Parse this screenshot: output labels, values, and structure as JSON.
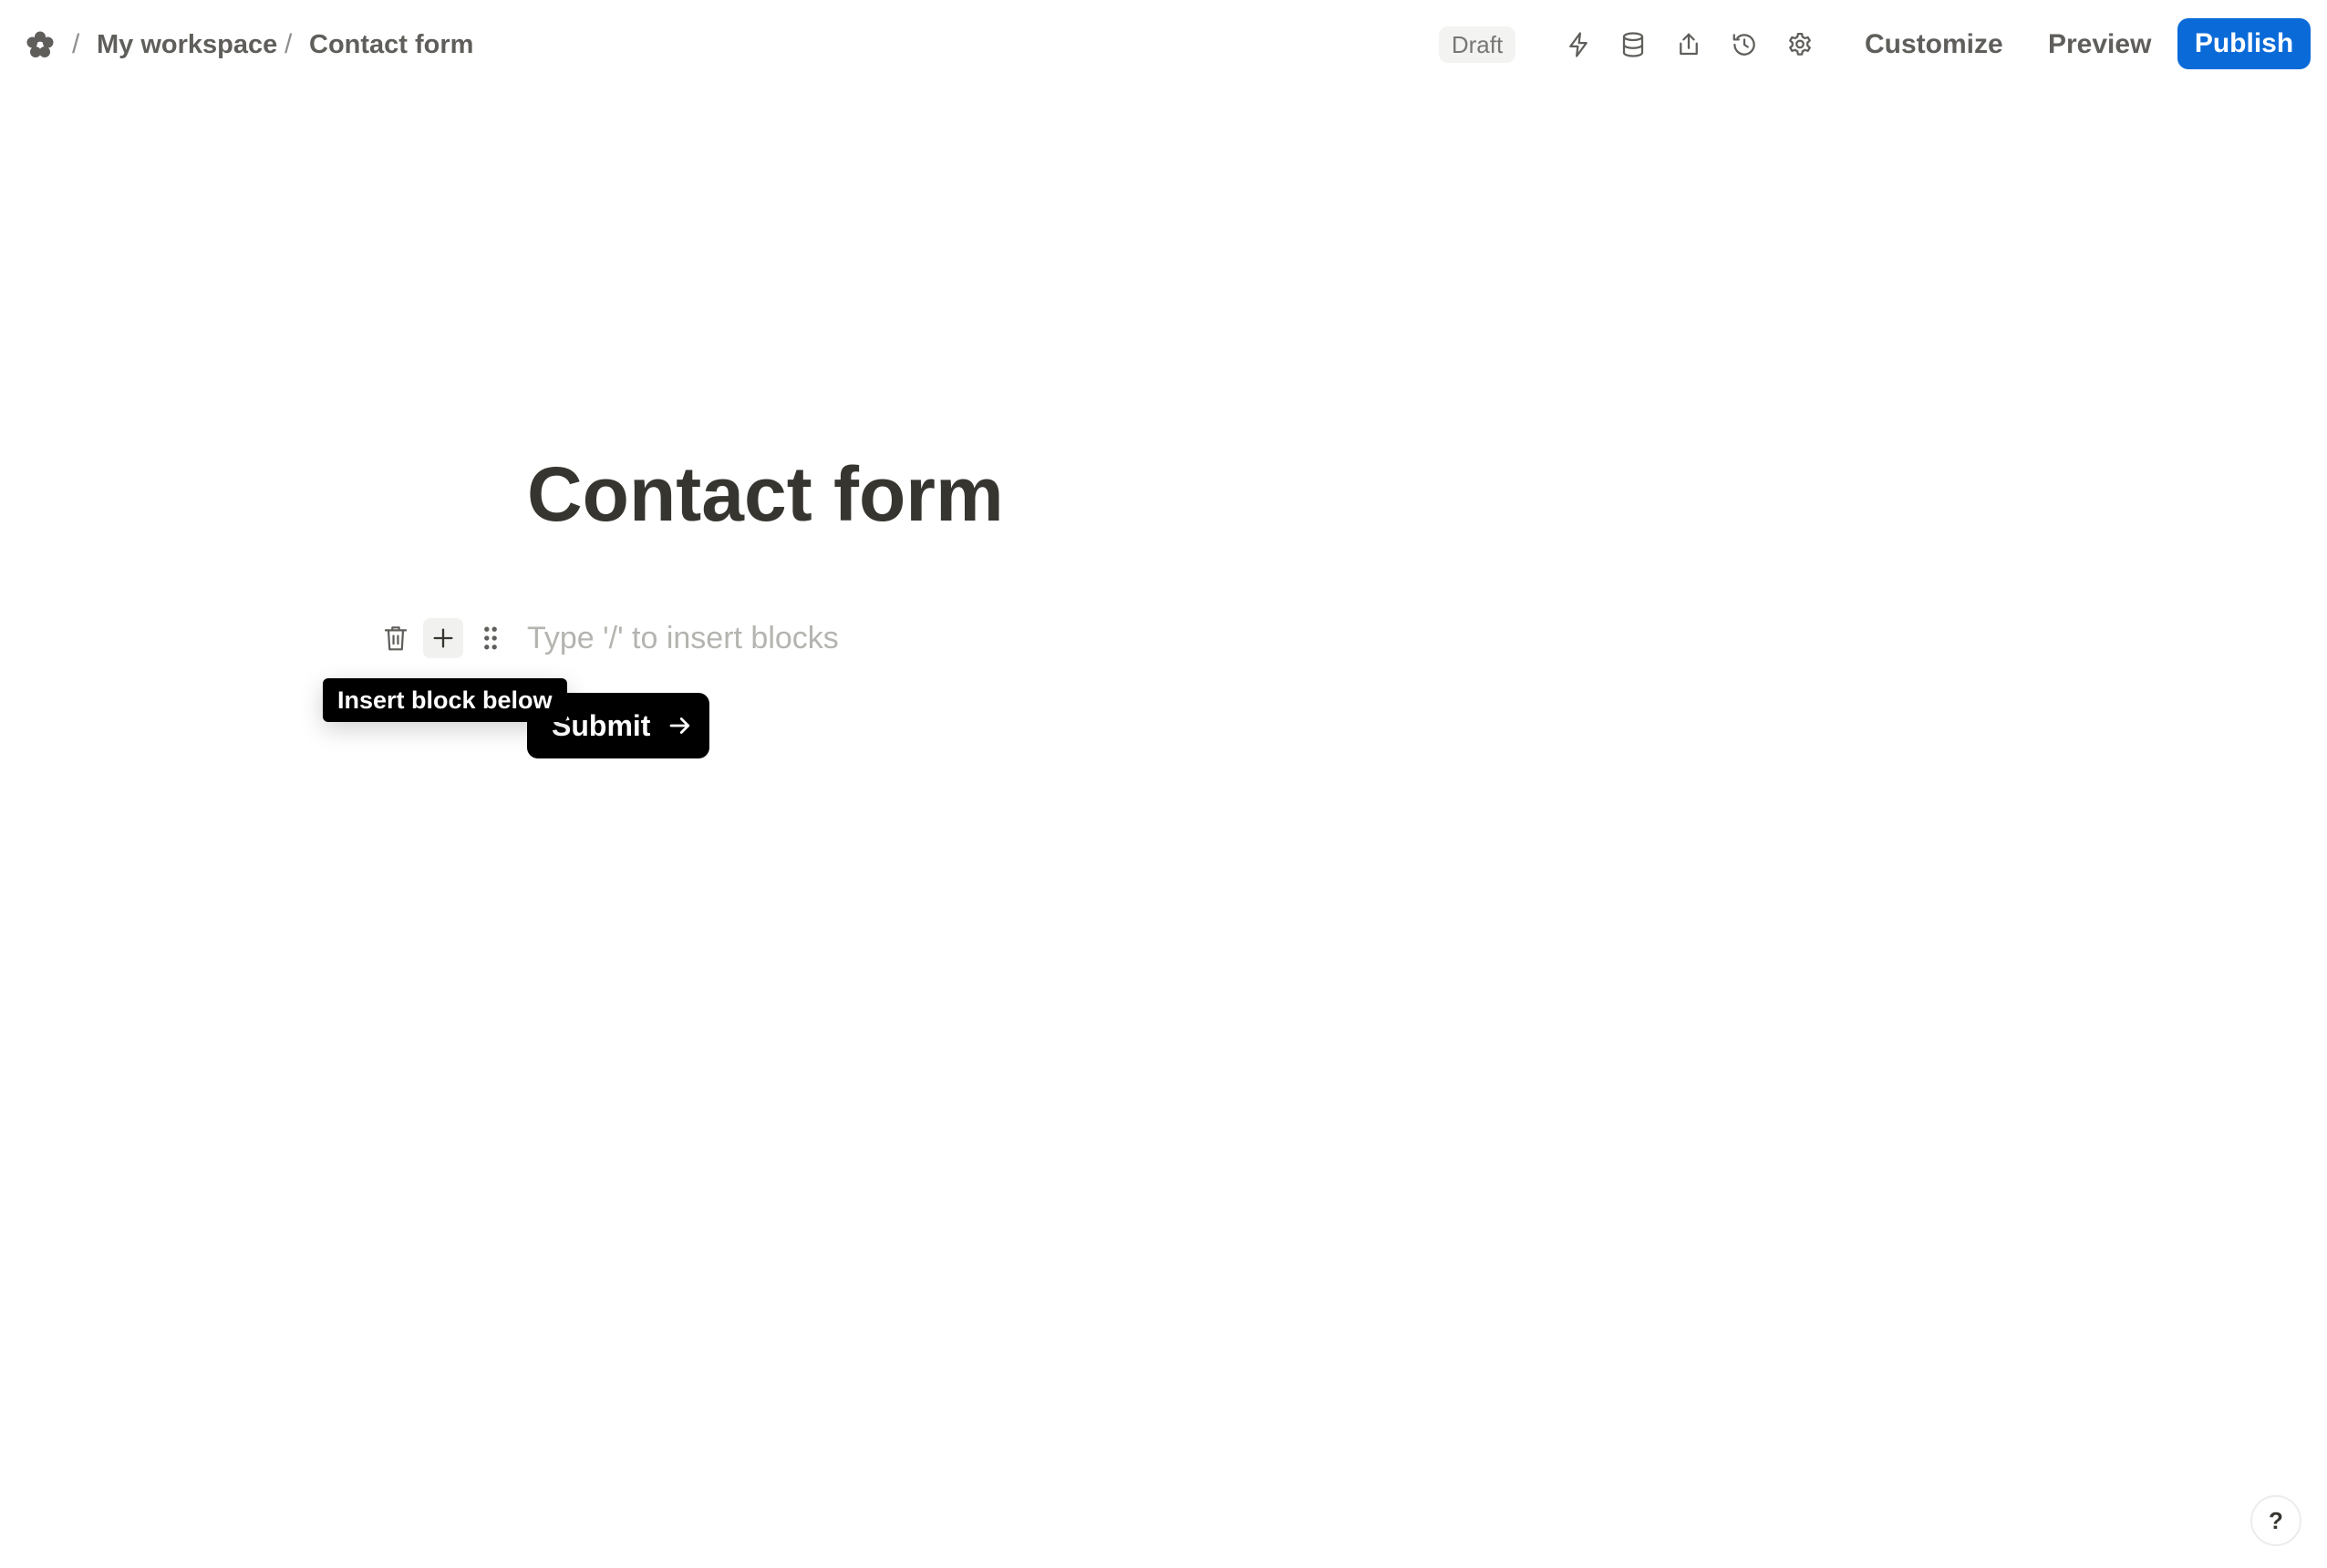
{
  "breadcrumb": {
    "separator": "/",
    "workspace": "My workspace",
    "page": "Contact form"
  },
  "toolbar": {
    "status_badge": "Draft",
    "icons": [
      "integrations-lightning-icon",
      "database-icon",
      "share-upload-icon",
      "history-icon",
      "settings-gear-icon"
    ],
    "customize_label": "Customize",
    "preview_label": "Preview",
    "publish_label": "Publish",
    "publish_color": "#0a6bd8"
  },
  "form": {
    "title": "Contact form",
    "block_placeholder": "Type '/' to insert blocks",
    "submit_label": "Submit",
    "submit_color": "#000000"
  },
  "tooltip": {
    "text": "Insert block below"
  },
  "help": {
    "label": "?"
  }
}
